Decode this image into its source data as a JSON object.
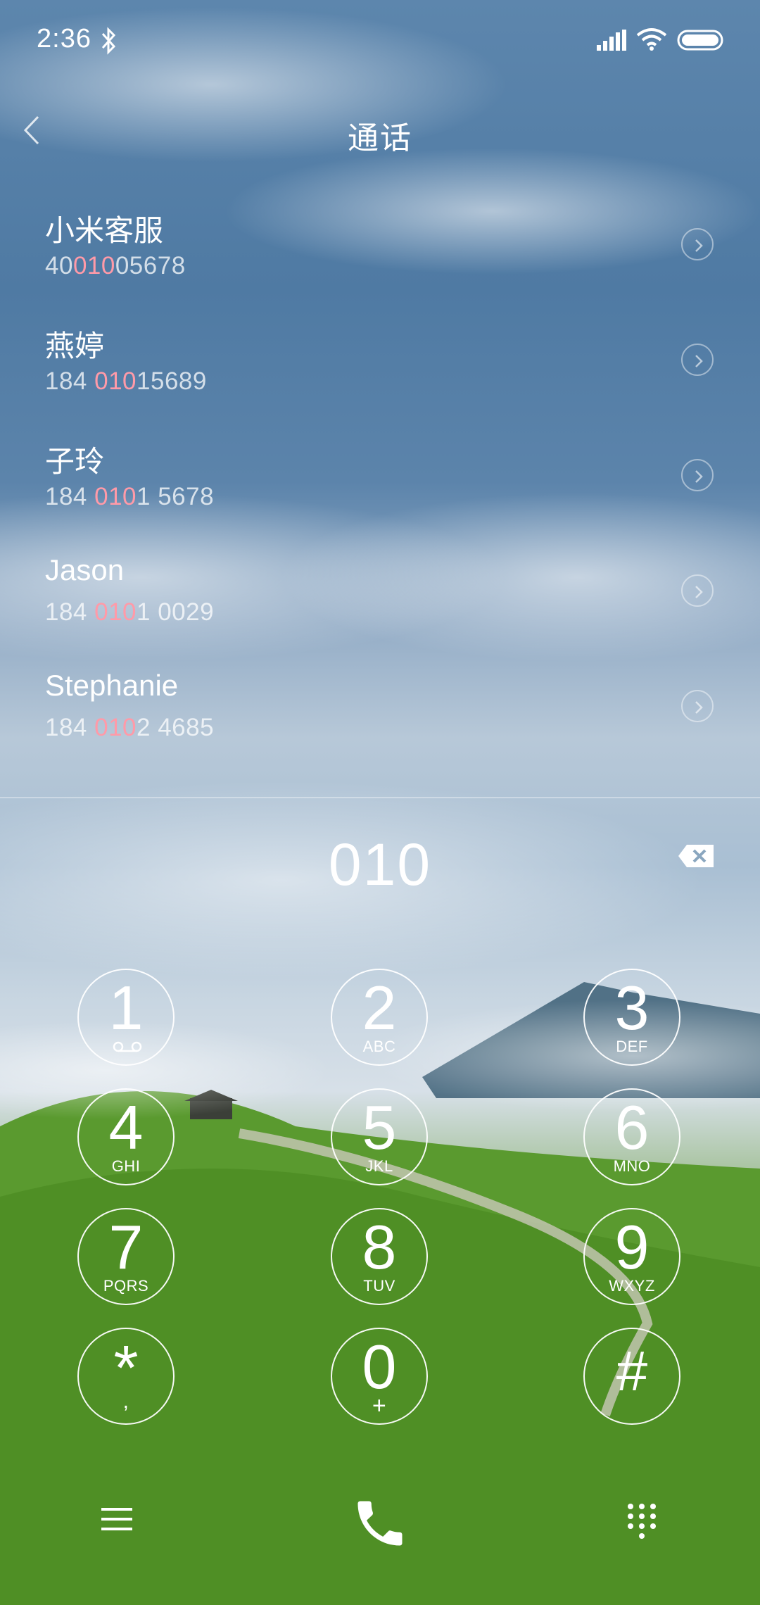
{
  "status_bar": {
    "time": "2:36"
  },
  "header": {
    "title": "通话"
  },
  "contacts": [
    {
      "name": "小米客服",
      "number_parts": [
        "40",
        "010",
        "05678"
      ]
    },
    {
      "name": "燕婷",
      "number_parts": [
        "184 ",
        "010",
        "15689"
      ]
    },
    {
      "name": "子玲",
      "number_parts": [
        "184 ",
        "010",
        "1 5678"
      ]
    },
    {
      "name": "Jason",
      "number_parts": [
        "184 ",
        "010",
        "1 0029"
      ]
    },
    {
      "name": "Stephanie",
      "number_parts": [
        "184 ",
        "010",
        "2 4685"
      ]
    }
  ],
  "dialer": {
    "entered_number": "010"
  },
  "keypad": [
    {
      "digit": "1",
      "letters": ""
    },
    {
      "digit": "2",
      "letters": "ABC"
    },
    {
      "digit": "3",
      "letters": "DEF"
    },
    {
      "digit": "4",
      "letters": "GHI"
    },
    {
      "digit": "5",
      "letters": "JKL"
    },
    {
      "digit": "6",
      "letters": "MNO"
    },
    {
      "digit": "7",
      "letters": "PQRS"
    },
    {
      "digit": "8",
      "letters": "TUV"
    },
    {
      "digit": "9",
      "letters": "WXYZ"
    },
    {
      "digit": "*",
      "letters": ","
    },
    {
      "digit": "0",
      "letters": "+"
    },
    {
      "digit": "#",
      "letters": ""
    }
  ],
  "colors": {
    "highlight": "#ff9aa8"
  },
  "icons": [
    "bluetooth-icon",
    "signal-icon",
    "wifi-icon",
    "battery-icon",
    "back-icon",
    "detail-icon",
    "backspace-icon",
    "voicemail-icon",
    "menu-icon",
    "phone-icon",
    "keypad-icon"
  ]
}
